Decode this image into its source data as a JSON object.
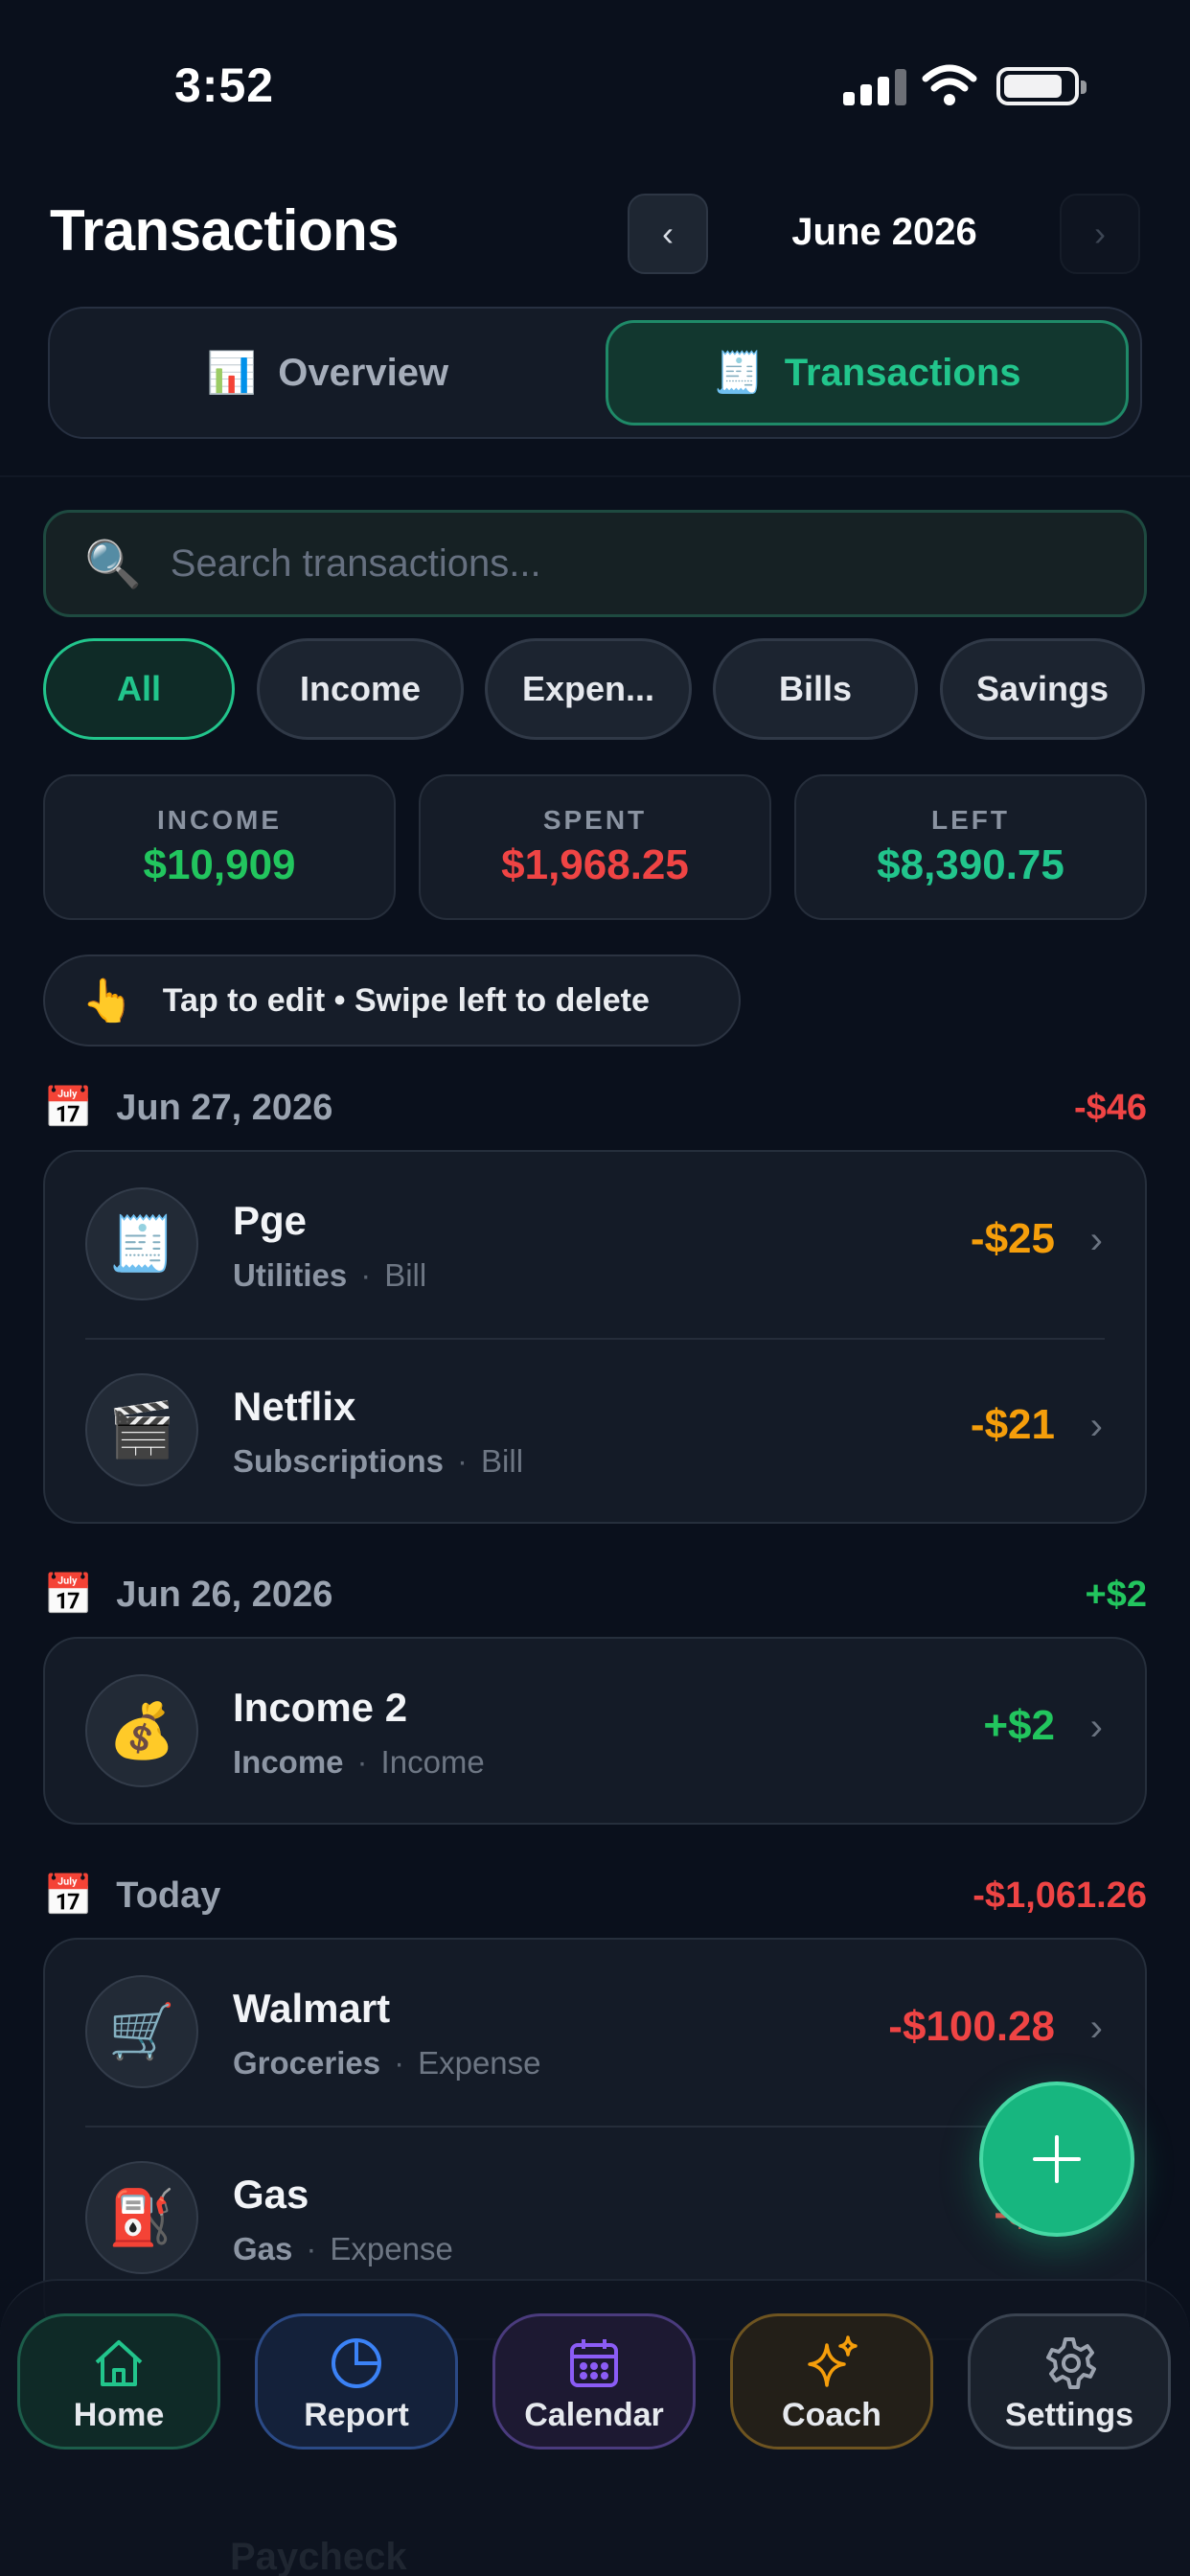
{
  "status_bar": {
    "time": "3:52"
  },
  "header": {
    "title": "Transactions",
    "month": "June 2026",
    "prev_glyph": "‹",
    "next_glyph": "›"
  },
  "segments": [
    {
      "label": "Overview",
      "icon": "bar-chart-icon",
      "glyph": "📊",
      "active": false
    },
    {
      "label": "Transactions",
      "icon": "receipt-icon",
      "glyph": "🧾",
      "active": true
    }
  ],
  "search": {
    "placeholder": "Search transactions...",
    "value": "",
    "glyph": "🔍"
  },
  "filters": [
    {
      "label": "All",
      "active": true
    },
    {
      "label": "Income",
      "active": false
    },
    {
      "label": "Expen...",
      "active": false
    },
    {
      "label": "Bills",
      "active": false
    },
    {
      "label": "Savings",
      "active": false
    }
  ],
  "summary": [
    {
      "label": "INCOME",
      "value": "$10,909",
      "color": "#22c55e"
    },
    {
      "label": "SPENT",
      "value": "$1,968.25",
      "color": "#ef4444"
    },
    {
      "label": "LEFT",
      "value": "$8,390.75",
      "color": "#22c58c"
    }
  ],
  "hint": {
    "glyph": "👆",
    "text": "Tap to edit • Swipe left to delete"
  },
  "groups": [
    {
      "date": "Jun 27, 2026",
      "total": "-$46",
      "total_color": "#ef4444",
      "items": [
        {
          "icon": "receipt-icon",
          "glyph": "🧾",
          "name": "Pge",
          "category": "Utilities",
          "type": "Bill",
          "amount": "-$25",
          "color": "#f59e0b"
        },
        {
          "icon": "clapperboard-icon",
          "glyph": "🎬",
          "name": "Netflix",
          "category": "Subscriptions",
          "type": "Bill",
          "amount": "-$21",
          "color": "#f59e0b"
        }
      ]
    },
    {
      "date": "Jun 26, 2026",
      "total": "+$2",
      "total_color": "#22c55e",
      "items": [
        {
          "icon": "money-bag-icon",
          "glyph": "💰",
          "name": "Income 2",
          "category": "Income",
          "type": "Income",
          "amount": "+$2",
          "color": "#22c55e"
        }
      ]
    },
    {
      "date": "Today",
      "total": "-$1,061.26",
      "total_color": "#ef4444",
      "items": [
        {
          "icon": "shopping-cart-icon",
          "glyph": "🛒",
          "name": "Walmart",
          "category": "Groceries",
          "type": "Expense",
          "amount": "-$100.28",
          "color": "#ef4444"
        },
        {
          "icon": "fuel-pump-icon",
          "glyph": "⛽",
          "name": "Gas",
          "category": "Gas",
          "type": "Expense",
          "amount": "-$3",
          "color": "#ef4444"
        }
      ]
    }
  ],
  "peek_text": "Paycheck",
  "fab": {
    "icon": "plus-icon"
  },
  "bottom_nav": [
    {
      "label": "Home",
      "icon": "home-icon",
      "color": "#22c58c"
    },
    {
      "label": "Report",
      "icon": "pie-chart-icon",
      "color": "#3b82f6"
    },
    {
      "label": "Calendar",
      "icon": "calendar-icon",
      "color": "#8b5cf6"
    },
    {
      "label": "Coach",
      "icon": "sparkles-icon",
      "color": "#f59e0b"
    },
    {
      "label": "Settings",
      "icon": "gear-icon",
      "color": "#9ca3af"
    }
  ],
  "colors": {
    "accent": "#22c58c",
    "background": "#0a101c",
    "card": "#141b27"
  }
}
